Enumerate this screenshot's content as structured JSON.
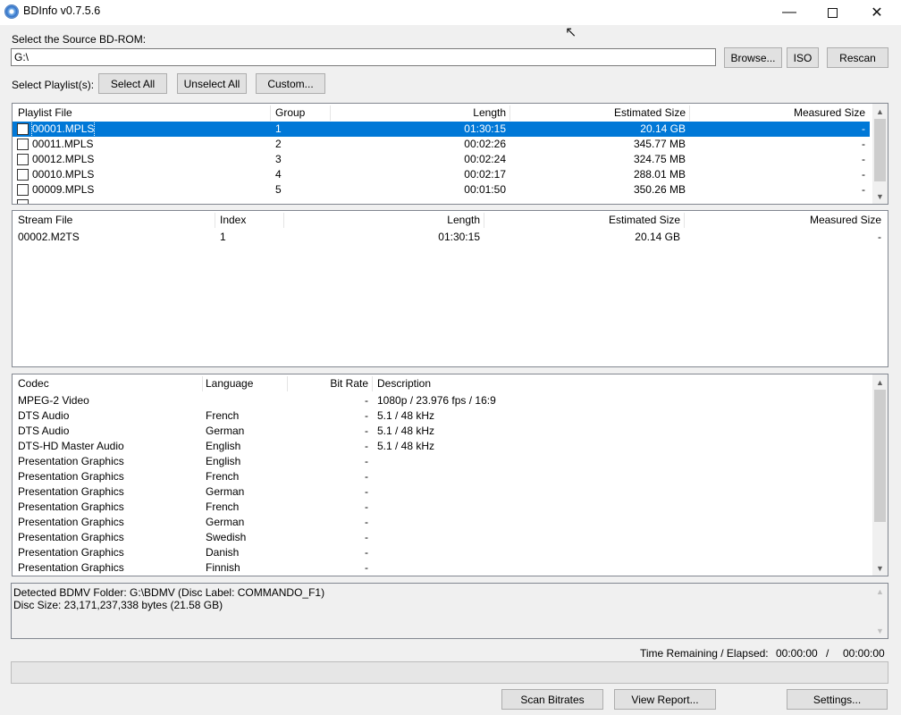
{
  "window": {
    "title": "BDInfo v0.7.5.6",
    "minimize_glyph": "—",
    "close_glyph": "✕",
    "icon": "disc-icon"
  },
  "source": {
    "label": "Select the Source BD-ROM:",
    "path": "G:\\",
    "browse_label": "Browse...",
    "iso_label": "ISO",
    "rescan_label": "Rescan"
  },
  "playlist_controls": {
    "label": "Select Playlist(s):",
    "select_all_label": "Select All",
    "unselect_all_label": "Unselect All",
    "custom_label": "Custom..."
  },
  "playlists": {
    "columns": [
      "Playlist File",
      "Group",
      "Length",
      "Estimated Size",
      "Measured Size"
    ],
    "rows": [
      {
        "file": "00001.MPLS",
        "group": "1",
        "length": "01:30:15",
        "estimated": "20.14 GB",
        "measured": "-",
        "selected": true
      },
      {
        "file": "00011.MPLS",
        "group": "2",
        "length": "00:02:26",
        "estimated": "345.77 MB",
        "measured": "-"
      },
      {
        "file": "00012.MPLS",
        "group": "3",
        "length": "00:02:24",
        "estimated": "324.75 MB",
        "measured": "-"
      },
      {
        "file": "00010.MPLS",
        "group": "4",
        "length": "00:02:17",
        "estimated": "288.01 MB",
        "measured": "-"
      },
      {
        "file": "00009.MPLS",
        "group": "5",
        "length": "00:01:50",
        "estimated": "350.26 MB",
        "measured": "-"
      }
    ]
  },
  "streams": {
    "columns": [
      "Stream File",
      "Index",
      "Length",
      "Estimated Size",
      "Measured Size"
    ],
    "rows": [
      {
        "file": "00002.M2TS",
        "index": "1",
        "length": "01:30:15",
        "estimated": "20.14 GB",
        "measured": "-"
      }
    ]
  },
  "codecs": {
    "columns": [
      "Codec",
      "Language",
      "Bit Rate",
      "Description"
    ],
    "rows": [
      {
        "codec": "MPEG-2 Video",
        "language": "",
        "bitrate": "-",
        "description": "1080p / 23.976 fps / 16:9"
      },
      {
        "codec": "DTS Audio",
        "language": "French",
        "bitrate": "-",
        "description": "5.1 / 48 kHz"
      },
      {
        "codec": "DTS Audio",
        "language": "German",
        "bitrate": "-",
        "description": "5.1 / 48 kHz"
      },
      {
        "codec": "DTS-HD Master Audio",
        "language": "English",
        "bitrate": "-",
        "description": "5.1 / 48 kHz"
      },
      {
        "codec": "Presentation Graphics",
        "language": "English",
        "bitrate": "-",
        "description": ""
      },
      {
        "codec": "Presentation Graphics",
        "language": "French",
        "bitrate": "-",
        "description": ""
      },
      {
        "codec": "Presentation Graphics",
        "language": "German",
        "bitrate": "-",
        "description": ""
      },
      {
        "codec": "Presentation Graphics",
        "language": "French",
        "bitrate": "-",
        "description": ""
      },
      {
        "codec": "Presentation Graphics",
        "language": "German",
        "bitrate": "-",
        "description": ""
      },
      {
        "codec": "Presentation Graphics",
        "language": "Swedish",
        "bitrate": "-",
        "description": ""
      },
      {
        "codec": "Presentation Graphics",
        "language": "Danish",
        "bitrate": "-",
        "description": ""
      },
      {
        "codec": "Presentation Graphics",
        "language": "Finnish",
        "bitrate": "-",
        "description": ""
      }
    ]
  },
  "report": {
    "line1": "Detected BDMV Folder: G:\\BDMV (Disc Label: COMMANDO_F1)",
    "line2": "Disc Size: 23,171,237,338 bytes (21.58 GB)"
  },
  "timing": {
    "label": "Time Remaining / Elapsed:",
    "remaining": "00:00:00",
    "separator": "/",
    "elapsed": "00:00:00"
  },
  "progress": {
    "fraction": 0
  },
  "actions": {
    "scan_label": "Scan Bitrates",
    "report_label": "View Report...",
    "settings_label": "Settings..."
  }
}
